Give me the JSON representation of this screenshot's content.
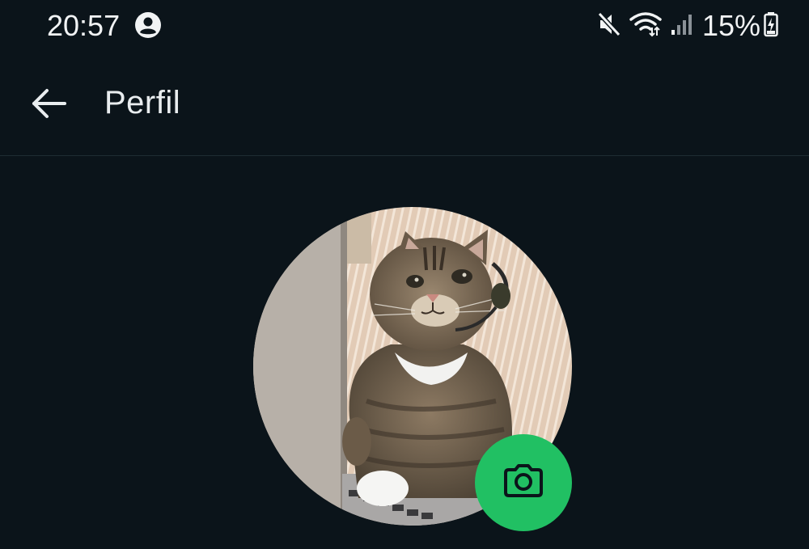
{
  "status_bar": {
    "time": "20:57",
    "battery_percent": "15%",
    "icons": [
      "account-circle-icon",
      "mute-icon",
      "wifi-icon",
      "cell-signal-icon",
      "battery-charging-icon"
    ]
  },
  "app_bar": {
    "back_icon": "arrow-left-icon",
    "title": "Perfil"
  },
  "profile": {
    "photo_subject": "tabby-cat-with-headset",
    "edit_photo_icon": "camera-icon",
    "accent_color": "#21c063"
  },
  "colors": {
    "background": "#0b141a",
    "text": "#e9edef",
    "divider": "#1f2c33"
  }
}
